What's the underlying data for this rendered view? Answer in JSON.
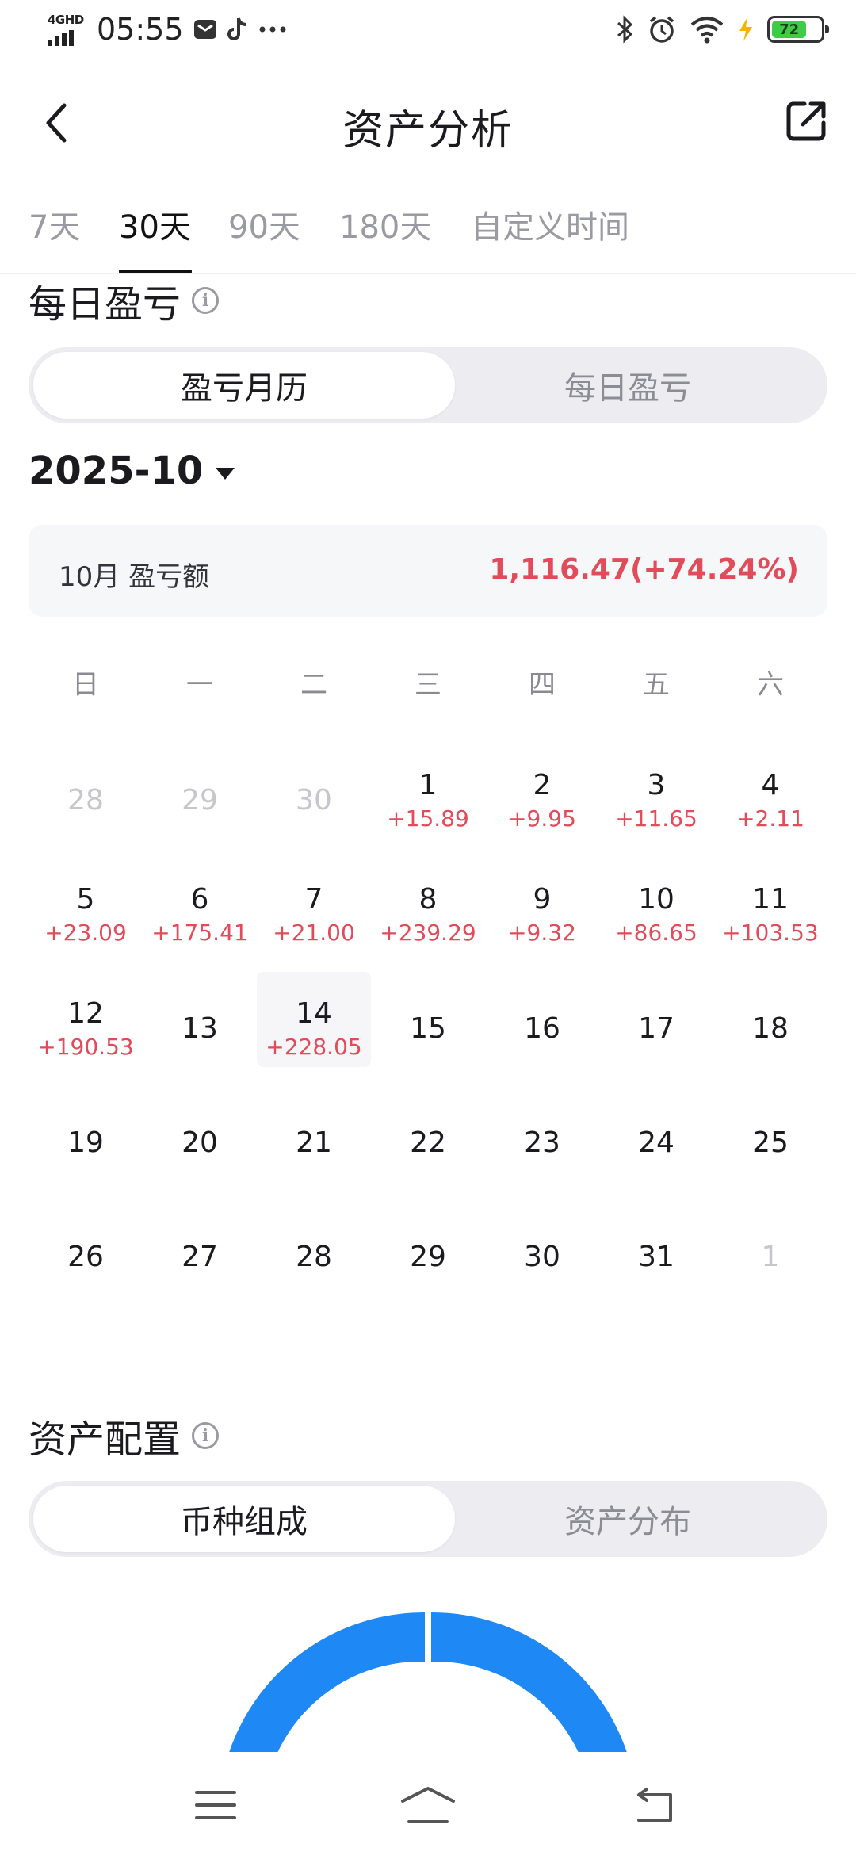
{
  "status_bar": {
    "network": "4GHD",
    "time": "05:55",
    "battery": "72"
  },
  "header": {
    "title": "资产分析"
  },
  "tabs": [
    {
      "label": "7天",
      "active": false
    },
    {
      "label": "30天",
      "active": true
    },
    {
      "label": "90天",
      "active": false
    },
    {
      "label": "180天",
      "active": false
    },
    {
      "label": "自定义时间",
      "active": false
    }
  ],
  "daily_pnl": {
    "title": "每日盈亏",
    "segments": [
      "盈亏月历",
      "每日盈亏"
    ],
    "selected_segment": "盈亏月历",
    "month": "2025-10",
    "summary_label": "10月 盈亏额",
    "summary_value": "1,116.47(+74.24%)",
    "weekdays": [
      "日",
      "一",
      "二",
      "三",
      "四",
      "五",
      "六"
    ],
    "days": [
      {
        "day": "28",
        "pnl": "",
        "muted": true
      },
      {
        "day": "29",
        "pnl": "",
        "muted": true
      },
      {
        "day": "30",
        "pnl": "",
        "muted": true
      },
      {
        "day": "1",
        "pnl": "+15.89"
      },
      {
        "day": "2",
        "pnl": "+9.95"
      },
      {
        "day": "3",
        "pnl": "+11.65"
      },
      {
        "day": "4",
        "pnl": "+2.11"
      },
      {
        "day": "5",
        "pnl": "+23.09"
      },
      {
        "day": "6",
        "pnl": "+175.41"
      },
      {
        "day": "7",
        "pnl": "+21.00"
      },
      {
        "day": "8",
        "pnl": "+239.29"
      },
      {
        "day": "9",
        "pnl": "+9.32"
      },
      {
        "day": "10",
        "pnl": "+86.65"
      },
      {
        "day": "11",
        "pnl": "+103.53"
      },
      {
        "day": "12",
        "pnl": "+190.53"
      },
      {
        "day": "13",
        "pnl": ""
      },
      {
        "day": "14",
        "pnl": "+228.05",
        "today": true
      },
      {
        "day": "15",
        "pnl": ""
      },
      {
        "day": "16",
        "pnl": ""
      },
      {
        "day": "17",
        "pnl": ""
      },
      {
        "day": "18",
        "pnl": ""
      },
      {
        "day": "19",
        "pnl": ""
      },
      {
        "day": "20",
        "pnl": ""
      },
      {
        "day": "21",
        "pnl": ""
      },
      {
        "day": "22",
        "pnl": ""
      },
      {
        "day": "23",
        "pnl": ""
      },
      {
        "day": "24",
        "pnl": ""
      },
      {
        "day": "25",
        "pnl": ""
      },
      {
        "day": "26",
        "pnl": ""
      },
      {
        "day": "27",
        "pnl": ""
      },
      {
        "day": "28",
        "pnl": ""
      },
      {
        "day": "29",
        "pnl": ""
      },
      {
        "day": "30",
        "pnl": ""
      },
      {
        "day": "31",
        "pnl": ""
      },
      {
        "day": "1",
        "pnl": "",
        "muted": true
      }
    ]
  },
  "allocation": {
    "title": "资产配置",
    "segments": [
      "币种组成",
      "资产分布"
    ],
    "selected_segment": "币种组成",
    "chart_color": "#1e88f5"
  },
  "colors": {
    "profit": "#e14b5a",
    "accent": "#1e88f5"
  },
  "icons": {
    "back": "chevron-left-icon",
    "share": "share-external-icon",
    "info": "info-icon",
    "menu": "menu-icon",
    "home": "home-icon",
    "return": "back-gesture-icon"
  }
}
